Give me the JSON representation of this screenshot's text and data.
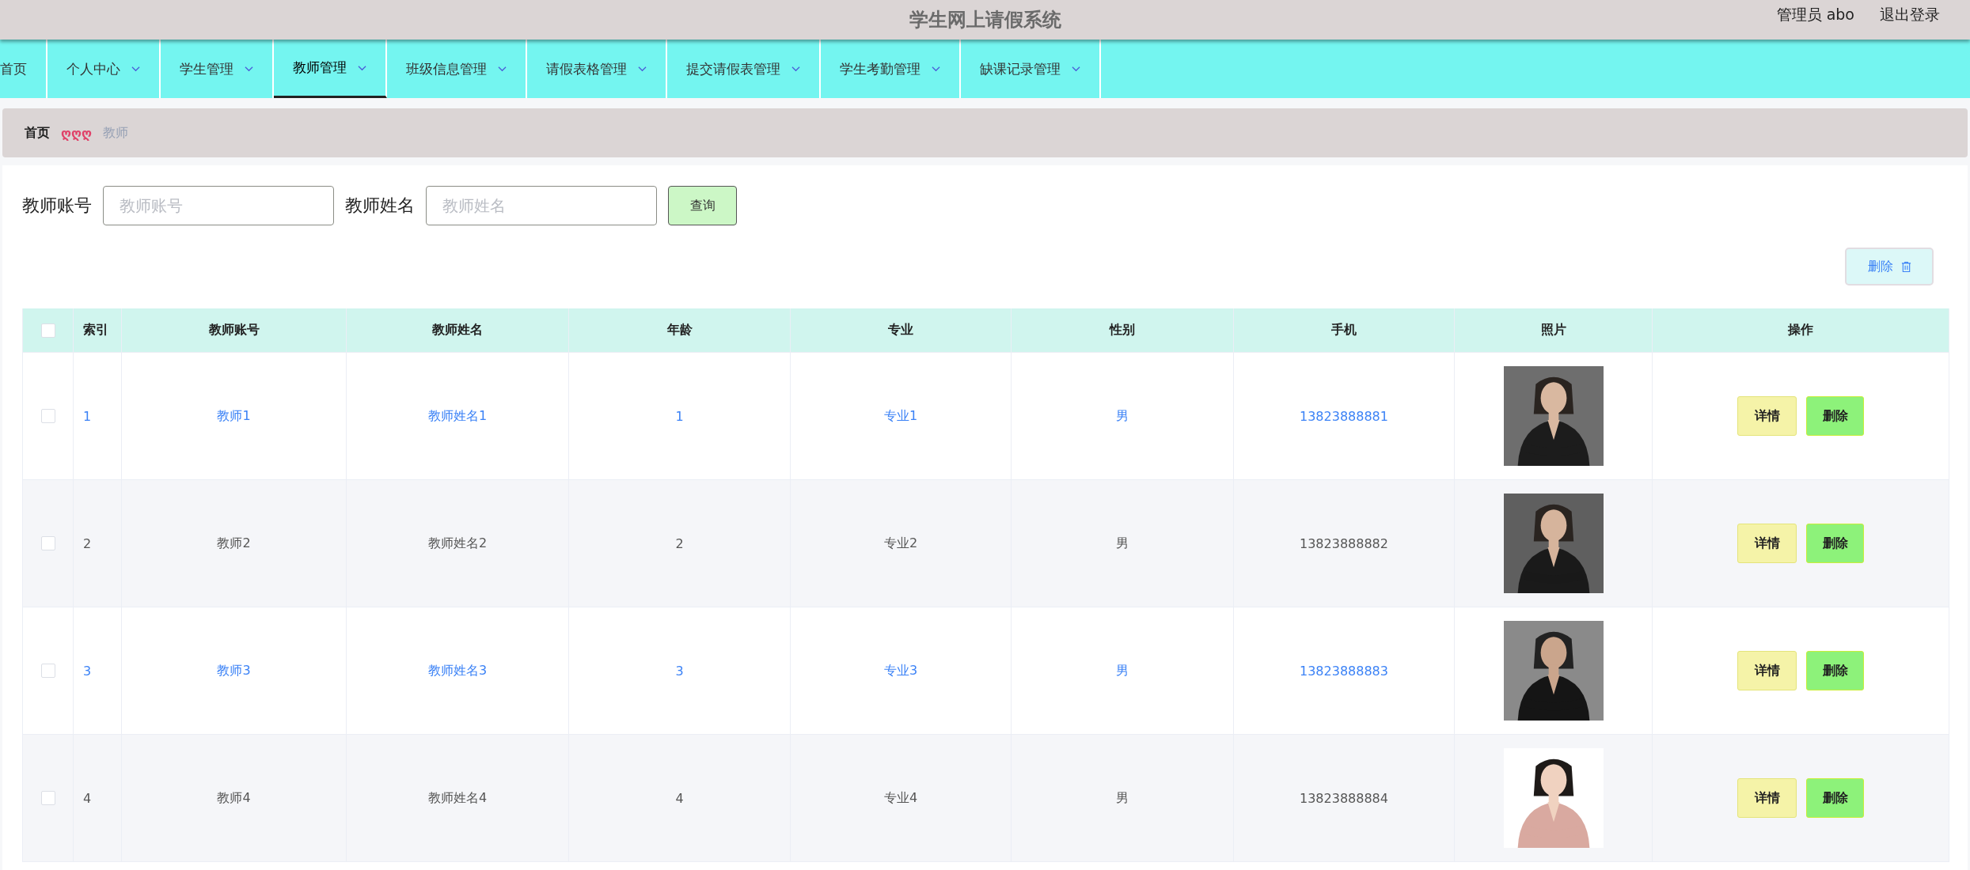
{
  "header": {
    "title": "学生网上请假系统",
    "user": "管理员 abo",
    "logout": "退出登录"
  },
  "nav": [
    {
      "label": "首页",
      "kind": "link",
      "selected": false
    },
    {
      "label": "个人中心",
      "kind": "menu",
      "selected": false
    },
    {
      "label": "学生管理",
      "kind": "menu",
      "selected": false
    },
    {
      "label": "教师管理",
      "kind": "menu",
      "selected": true
    },
    {
      "label": "班级信息管理",
      "kind": "menu",
      "selected": false
    },
    {
      "label": "请假表格管理",
      "kind": "menu",
      "selected": false
    },
    {
      "label": "提交请假表管理",
      "kind": "menu",
      "selected": false
    },
    {
      "label": "学生考勤管理",
      "kind": "menu",
      "selected": false
    },
    {
      "label": "缺课记录管理",
      "kind": "menu",
      "selected": false
    }
  ],
  "breadcrumb": {
    "home": "首页",
    "separator": "ღღღ",
    "current": "教师"
  },
  "search": [
    {
      "label": "教师账号",
      "placeholder": "教师账号"
    },
    {
      "label": "教师姓名",
      "placeholder": "教师姓名"
    }
  ],
  "query_button": "查询",
  "delete_button": "删除",
  "table": {
    "select_all_checked": false,
    "columns": [
      "索引",
      "教师账号",
      "教师姓名",
      "年龄",
      "专业",
      "性别",
      "手机",
      "照片",
      "操作"
    ],
    "rows": [
      {
        "checked": false,
        "highlighted": true,
        "cells": [
          "1",
          "教师1",
          "教师姓名1",
          "1",
          "专业1",
          "男",
          "13823888881"
        ],
        "actions": [
          "详情",
          "删除"
        ]
      },
      {
        "checked": false,
        "highlighted": false,
        "cells": [
          "2",
          "教师2",
          "教师姓名2",
          "2",
          "专业2",
          "男",
          "13823888882"
        ],
        "actions": [
          "详情",
          "删除"
        ]
      },
      {
        "checked": false,
        "highlighted": true,
        "cells": [
          "3",
          "教师3",
          "教师姓名3",
          "3",
          "专业3",
          "男",
          "13823888883"
        ],
        "actions": [
          "详情",
          "删除"
        ]
      },
      {
        "checked": false,
        "highlighted": false,
        "cells": [
          "4",
          "教师4",
          "教师姓名4",
          "4",
          "专业4",
          "男",
          "13823888884"
        ],
        "actions": [
          "详情",
          "删除"
        ]
      }
    ]
  }
}
